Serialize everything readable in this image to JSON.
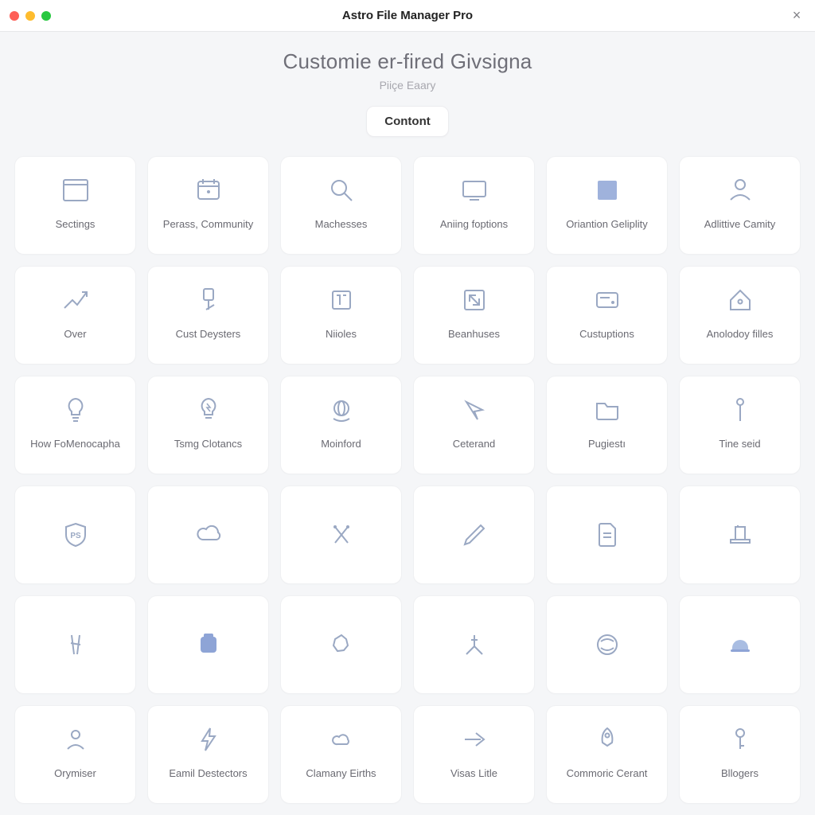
{
  "window": {
    "title": "Astro File Manager Pro",
    "close_label": "×"
  },
  "hero": {
    "heading": "Customie er-fired Givsigna",
    "subheading": "Piiçe Eaary",
    "pill": "Contont"
  },
  "tiles": [
    {
      "label": "Sectings",
      "icon": "window"
    },
    {
      "label": "Perass, Community",
      "icon": "calendar"
    },
    {
      "label": "Machesses",
      "icon": "search"
    },
    {
      "label": "Aniing foptions",
      "icon": "monitor"
    },
    {
      "label": "Oriantion Geliplity",
      "icon": "square-fill"
    },
    {
      "label": "Adlittive Camity",
      "icon": "user-bust"
    },
    {
      "label": "Over",
      "icon": "arrow-trend"
    },
    {
      "label": "Cust Deysters",
      "icon": "pin"
    },
    {
      "label": "Niioles",
      "icon": "text-box"
    },
    {
      "label": "Beanhuses",
      "icon": "expand"
    },
    {
      "label": "Custuptions",
      "icon": "card"
    },
    {
      "label": "Anolodoy filles",
      "icon": "house"
    },
    {
      "label": "How FoMenocapha",
      "icon": "bulb"
    },
    {
      "label": "Tsmg Clotancs",
      "icon": "bulb-spark"
    },
    {
      "label": "Moinford",
      "icon": "globe-ring"
    },
    {
      "label": "Ceterand",
      "icon": "cursor"
    },
    {
      "label": "Pugiestı",
      "icon": "folder"
    },
    {
      "label": "Tine seid",
      "icon": "pin-dot"
    },
    {
      "label": "",
      "icon": "shield-ps"
    },
    {
      "label": "",
      "icon": "cloud"
    },
    {
      "label": "",
      "icon": "cross-sticks"
    },
    {
      "label": "",
      "icon": "pencil"
    },
    {
      "label": "",
      "icon": "doc-lines"
    },
    {
      "label": "",
      "icon": "printer"
    },
    {
      "label": "",
      "icon": "sticks"
    },
    {
      "label": "",
      "icon": "stack-fill"
    },
    {
      "label": "",
      "icon": "blob"
    },
    {
      "label": "",
      "icon": "tripod"
    },
    {
      "label": "",
      "icon": "globe-face"
    },
    {
      "label": "",
      "icon": "helmet"
    },
    {
      "label": "Orymiser",
      "icon": "user"
    },
    {
      "label": "Eamil Destectors",
      "icon": "bolt"
    },
    {
      "label": "Clamany Eirths",
      "icon": "cloud-small"
    },
    {
      "label": "Visas Litle",
      "icon": "arrow-right"
    },
    {
      "label": "Commoric Cerant",
      "icon": "rocket"
    },
    {
      "label": "Bllogers",
      "icon": "key"
    }
  ]
}
